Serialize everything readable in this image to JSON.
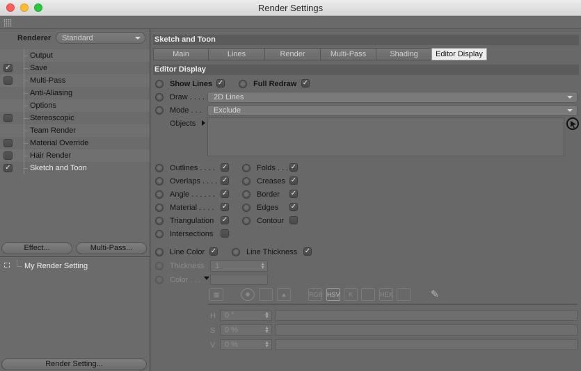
{
  "window": {
    "title": "Render Settings"
  },
  "left": {
    "renderer_label": "Renderer",
    "renderer_value": "Standard",
    "items": [
      {
        "label": "Output",
        "checkbox": null
      },
      {
        "label": "Save",
        "checkbox": true
      },
      {
        "label": "Multi-Pass",
        "checkbox": false
      },
      {
        "label": "Anti-Aliasing",
        "checkbox": null
      },
      {
        "label": "Options",
        "checkbox": null
      },
      {
        "label": "Stereoscopic",
        "checkbox": false
      },
      {
        "label": "Team Render",
        "checkbox": null
      },
      {
        "label": "Material Override",
        "checkbox": false
      },
      {
        "label": "Hair Render",
        "checkbox": false
      },
      {
        "label": "Sketch and Toon",
        "checkbox": true
      }
    ],
    "effect_button": "Effect...",
    "multipass_button": "Multi-Pass...",
    "setting_name": "My Render Setting",
    "render_setting_button": "Render Setting..."
  },
  "right": {
    "section_title": "Sketch and Toon",
    "tabs": [
      "Main",
      "Lines",
      "Render",
      "Multi-Pass",
      "Shading",
      "Editor Display"
    ],
    "active_tab": "Editor Display",
    "sub_title": "Editor Display",
    "show_lines": {
      "label": "Show Lines",
      "checked": true
    },
    "full_redraw": {
      "label": "Full Redraw",
      "checked": true
    },
    "draw": {
      "label": "Draw . . . .",
      "value": "2D Lines"
    },
    "mode": {
      "label": "Mode . . .",
      "value": "Exclude"
    },
    "objects_label": "Objects",
    "left_checks": [
      {
        "label": "Outlines . . . .",
        "checked": true
      },
      {
        "label": "Overlaps . . . .",
        "checked": true
      },
      {
        "label": "Angle . . . . . .",
        "checked": true
      },
      {
        "label": "Material . . . .",
        "checked": true
      },
      {
        "label": "Triangulation",
        "checked": true
      },
      {
        "label": "Intersections",
        "checked": false
      }
    ],
    "right_checks": [
      {
        "label": "Folds . . . .",
        "checked": true
      },
      {
        "label": "Creases",
        "checked": true
      },
      {
        "label": "Border",
        "checked": true
      },
      {
        "label": "Edges",
        "checked": true
      },
      {
        "label": "Contour",
        "checked": false
      }
    ],
    "line_color": {
      "label": "Line Color",
      "checked": true
    },
    "line_thickness": {
      "label": "Line Thickness",
      "checked": true
    },
    "thickness": {
      "label": "Thickness",
      "value": "1"
    },
    "color_label": "Color . . .",
    "color_tools": [
      "RGB",
      "HSV",
      "K",
      "",
      "HEX",
      ""
    ],
    "h": {
      "label": "H",
      "value": "0 °"
    },
    "s": {
      "label": "S",
      "value": "0 %"
    },
    "v": {
      "label": "V",
      "value": "0 %"
    }
  }
}
